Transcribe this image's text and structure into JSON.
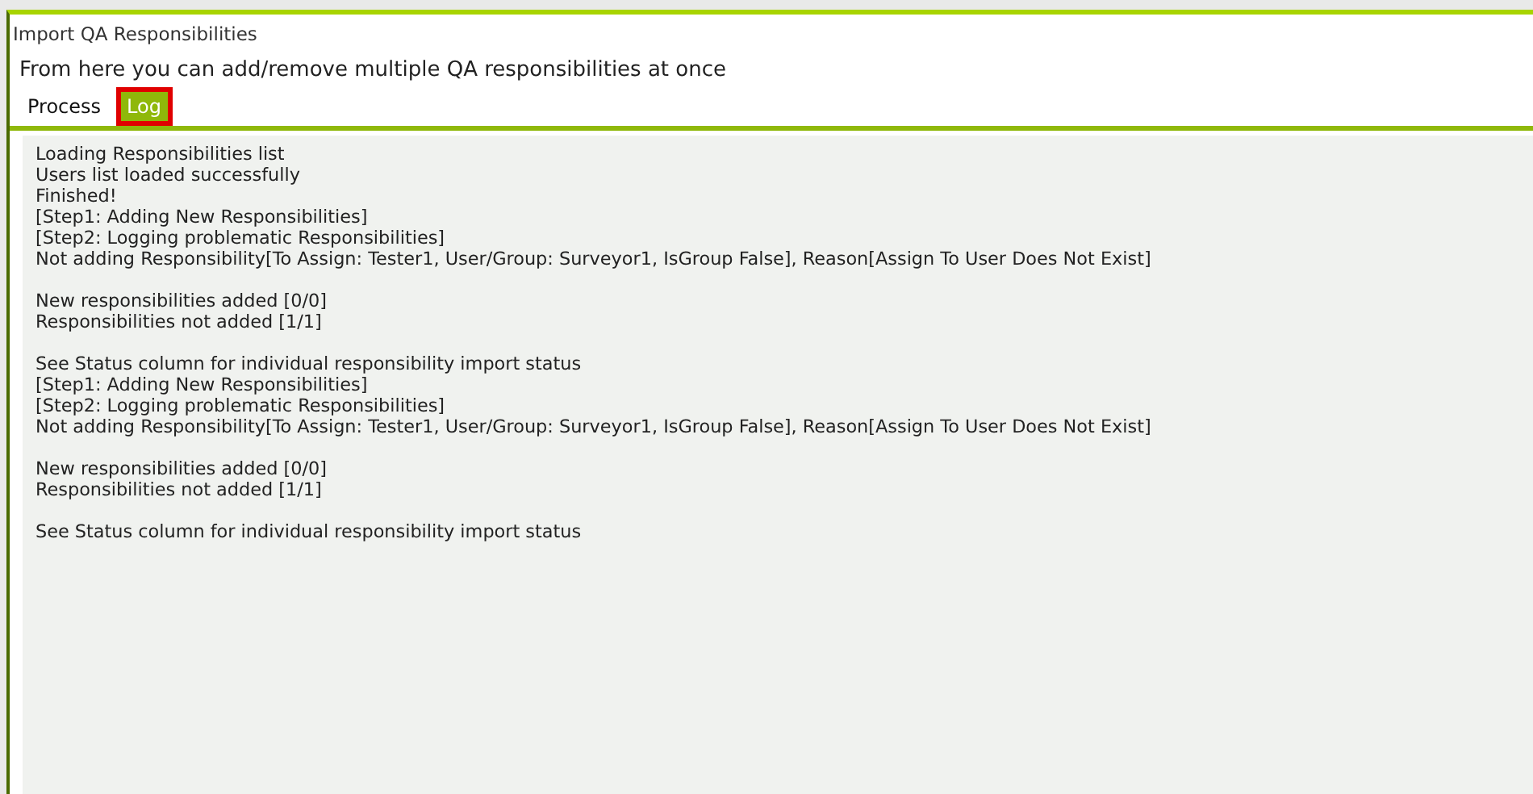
{
  "window": {
    "title": "Import QA Responsibilities"
  },
  "subtitle": "From here you can add/remove multiple QA responsibilities at once",
  "tabs": [
    {
      "label": "Process",
      "selected": false,
      "focused": false
    },
    {
      "label": "Log",
      "selected": true,
      "focused": true
    }
  ],
  "log": {
    "blocks": [
      [
        "Loading Responsibilities list",
        "Users list loaded successfully",
        "Finished!",
        "[Step1: Adding New Responsibilities]",
        "[Step2: Logging problematic Responsibilities]",
        "Not adding Responsibility[To Assign: Tester1, User/Group: Surveyor1, IsGroup False], Reason[Assign To User Does Not Exist]"
      ],
      [
        "New responsibilities added [0/0]",
        "Responsibilities not added [1/1]"
      ],
      [
        "See Status column for individual responsibility import status",
        "[Step1: Adding New Responsibilities]",
        "[Step2: Logging problematic Responsibilities]",
        "Not adding Responsibility[To Assign: Tester1, User/Group: Surveyor1, IsGroup False], Reason[Assign To User Does Not Exist]"
      ],
      [
        "New responsibilities added [0/0]",
        "Responsibilities not added [1/1]"
      ],
      [
        "See Status column for individual responsibility import status"
      ]
    ]
  }
}
